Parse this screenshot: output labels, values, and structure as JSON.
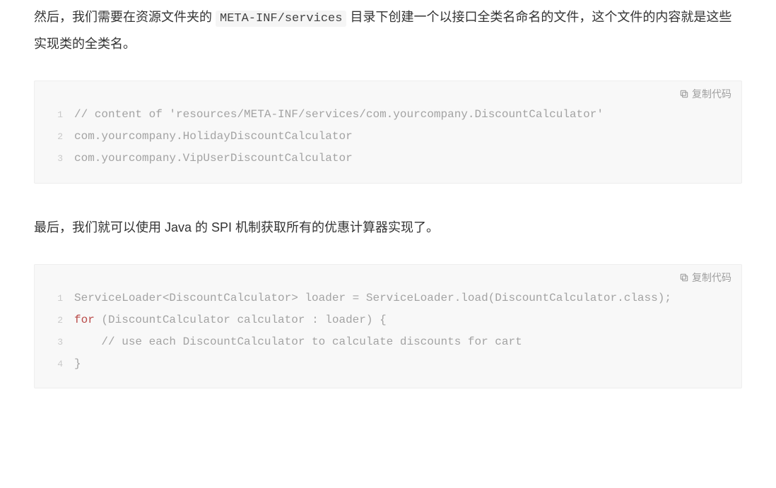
{
  "paragraph1": {
    "part1": "然后，我们需要在资源文件夹的 ",
    "inline_code": "META-INF/services",
    "part2": " 目录下创建一个以接口全类名命名的文件，这个文件的内容就是这些实现类的全类名。"
  },
  "copy_label": "复制代码",
  "code_block1": {
    "lines": [
      {
        "num": "1",
        "tokens": [
          {
            "cls": "tok-comment",
            "text": "// content of 'resources/META-INF/services/com.yourcompany.DiscountCalculator'"
          }
        ]
      },
      {
        "num": "2",
        "tokens": [
          {
            "cls": "tok-plain",
            "text": "com.yourcompany.HolidayDiscountCalculator"
          }
        ]
      },
      {
        "num": "3",
        "tokens": [
          {
            "cls": "tok-plain",
            "text": "com.yourcompany.VipUserDiscountCalculator"
          }
        ]
      }
    ]
  },
  "paragraph2": "最后，我们就可以使用 Java 的 SPI 机制获取所有的优惠计算器实现了。",
  "code_block2": {
    "lines": [
      {
        "num": "1",
        "tokens": [
          {
            "cls": "tok-plain",
            "text": "ServiceLoader<DiscountCalculator> loader = ServiceLoader.load(DiscountCalculator.class);"
          }
        ]
      },
      {
        "num": "2",
        "tokens": [
          {
            "cls": "tok-keyword",
            "text": "for"
          },
          {
            "cls": "tok-plain",
            "text": " (DiscountCalculator calculator : loader) {"
          }
        ]
      },
      {
        "num": "3",
        "tokens": [
          {
            "cls": "tok-indent",
            "text": "    "
          },
          {
            "cls": "tok-comment",
            "text": "// use each DiscountCalculator to calculate discounts for cart"
          }
        ]
      },
      {
        "num": "4",
        "tokens": [
          {
            "cls": "tok-plain",
            "text": "}"
          }
        ]
      }
    ]
  }
}
